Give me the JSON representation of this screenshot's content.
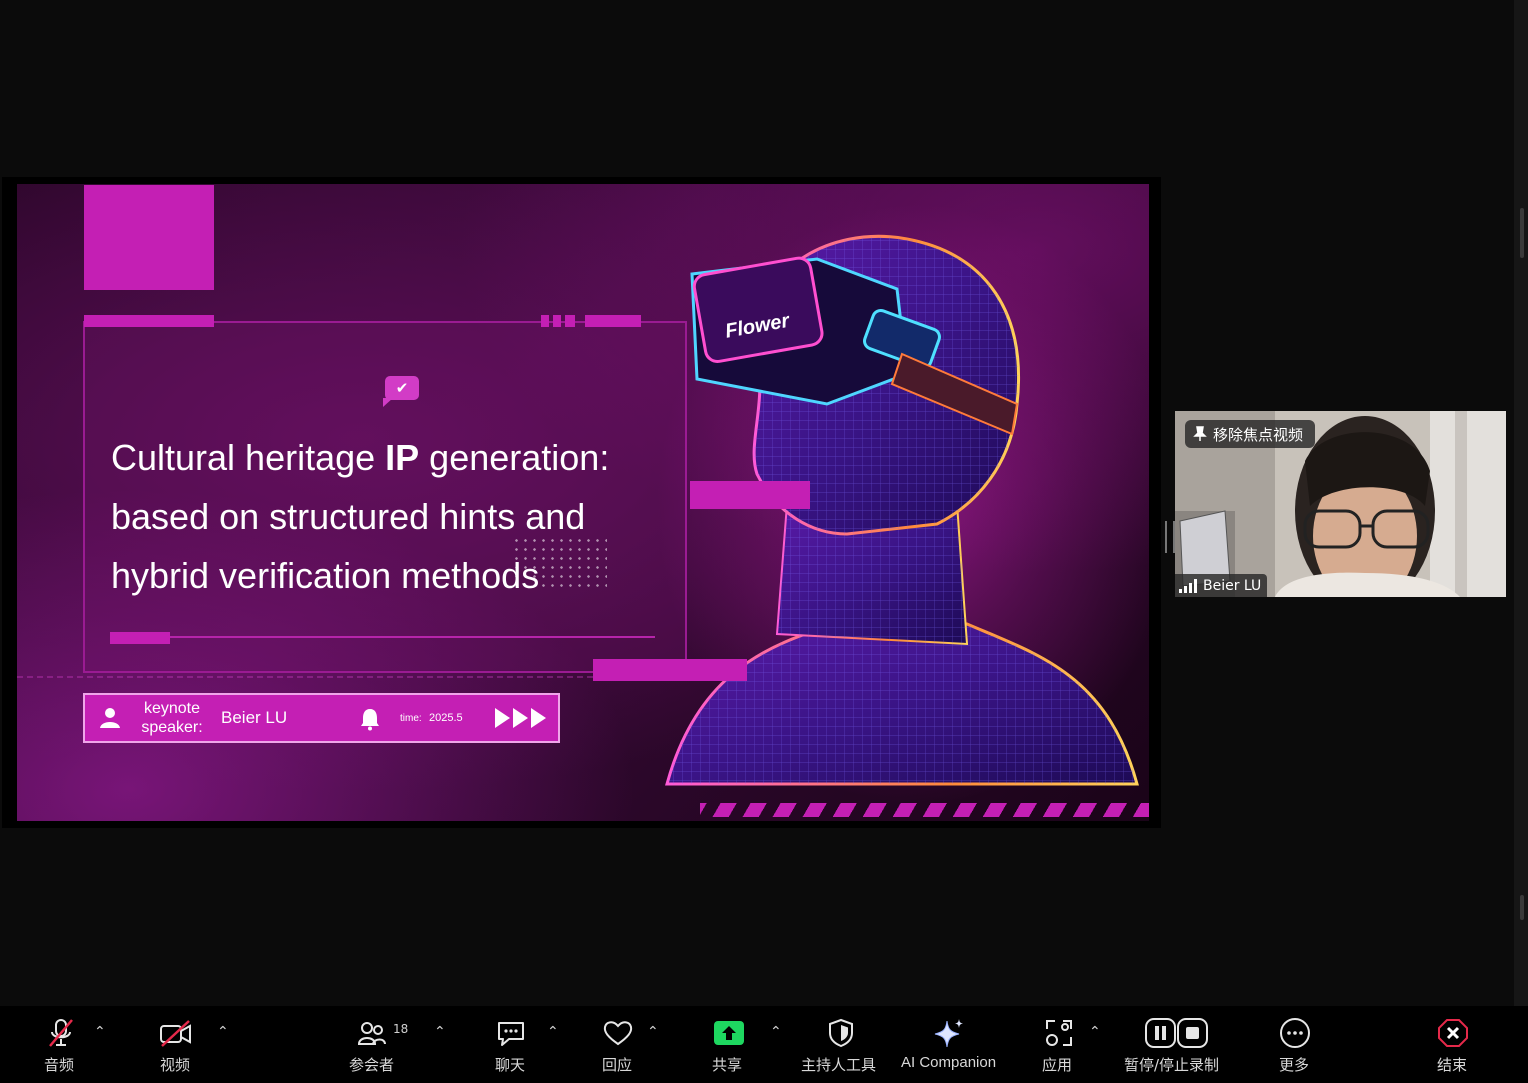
{
  "slide": {
    "title_part1": "Cultural heritage ",
    "title_bold": "IP",
    "title_part2": " generation:",
    "title_line2": "based on structured hints and",
    "title_line3": "hybrid verification methods",
    "headset_label": "Flower",
    "speaker_label": "keynote speaker:",
    "speaker_name": "Beier LU",
    "time_label": "time:",
    "time_value": "2025.5",
    "accent_color": "#c41fb4"
  },
  "participant": {
    "pin_label": "移除焦点视频",
    "name": "Beier LU"
  },
  "toolbar": {
    "audio": "音频",
    "video": "视频",
    "participants": "参会者",
    "participants_count": "18",
    "chat": "聊天",
    "reactions": "回应",
    "share": "共享",
    "host_tools": "主持人工具",
    "ai_companion": "AI Companion",
    "apps": "应用",
    "record": "暂停/停止录制",
    "more": "更多",
    "end": "结束",
    "share_color": "#1ed760",
    "end_color": "#e5294a"
  }
}
